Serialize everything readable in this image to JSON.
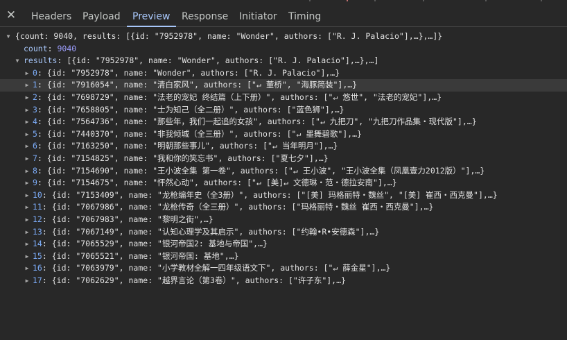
{
  "colors": {
    "background": "#282828",
    "tab_active": "#a8c7fa",
    "key": "#a8c7fa",
    "number": "#9e9fff"
  },
  "tabs": [
    {
      "label": "Headers"
    },
    {
      "label": "Payload"
    },
    {
      "label": "Preview"
    },
    {
      "label": "Response"
    },
    {
      "label": "Initiator"
    },
    {
      "label": "Timing"
    }
  ],
  "close_glyph": "✕",
  "tree": {
    "root_summary": "{count: 9040, results: [{id: \"7952978\", name: \"Wonder\", authors: [\"R. J. Palacio\"],…},…]}",
    "count_key": "count",
    "count_value": "9040",
    "results_key": "results",
    "results_summary": "[{id: \"7952978\", name: \"Wonder\", authors: [\"R. J. Palacio\"],…},…]",
    "items": [
      {
        "index": "0",
        "text": "{id: \"7952978\", name: \"Wonder\", authors: [\"R. J. Palacio\"],…}"
      },
      {
        "index": "1",
        "text": "{id: \"7916054\", name: \"清白家风\", authors: [\"↵ 董桥\", \"海豚简装\"],…}"
      },
      {
        "index": "2",
        "text": "{id: \"7698729\", name: \"法老的宠妃 终结篇（上下册）\", authors: [\"↵ 悠世\", \"法老的宠妃\"],…}"
      },
      {
        "index": "3",
        "text": "{id: \"7658805\", name: \"士为知己（全二册）\", authors: [\"蓝色狮\"],…}"
      },
      {
        "index": "4",
        "text": "{id: \"7564736\", name: \"那些年，我们一起追的女孩\", authors: [\"↵ 九把刀\", \"九把刀作品集・现代版\"],…}"
      },
      {
        "index": "5",
        "text": "{id: \"7440370\", name: \"非我倾城（全三册）\", authors: [\"↵ 墨舞碧歌\"],…}"
      },
      {
        "index": "6",
        "text": "{id: \"7163250\", name: \"明朝那些事儿\", authors: [\"↵ 当年明月\"],…}"
      },
      {
        "index": "7",
        "text": "{id: \"7154825\", name: \"我和你的笑忘书\", authors: [\"夏七夕\"],…}"
      },
      {
        "index": "8",
        "text": "{id: \"7154690\", name: \"王小波全集 第一卷\", authors: [\"↵ 王小波\", \"王小波全集（凤凰壹力2012版）\"],…}"
      },
      {
        "index": "9",
        "text": "{id: \"7154675\", name: \"怦然心动\", authors: [\"↵ [美]↵ 文德琳・范・德拉安南\"],…}"
      },
      {
        "index": "10",
        "text": "{id: \"7153409\", name: \"龙枪编年史（全3册）\", authors: [\"[美] 玛格丽特・魏丝\", \"[美] 崔西・西克曼\"],…}"
      },
      {
        "index": "11",
        "text": "{id: \"7067986\", name: \"龙枪传奇（全三册）\", authors: [\"玛格丽特・魏丝 崔西・西克曼\"],…}"
      },
      {
        "index": "12",
        "text": "{id: \"7067983\", name: \"黎明之街\",…}"
      },
      {
        "index": "13",
        "text": "{id: \"7067149\", name: \"认知心理学及其启示\", authors: [\"约翰•R•安德森\"],…}"
      },
      {
        "index": "14",
        "text": "{id: \"7065529\", name: \"银河帝国2: 基地与帝国\",…}"
      },
      {
        "index": "15",
        "text": "{id: \"7065521\", name: \"银河帝国: 基地\",…}"
      },
      {
        "index": "16",
        "text": "{id: \"7063979\", name: \"小学教材全解一四年级语文下\", authors: [\"↵ 薛金星\"],…}"
      },
      {
        "index": "17",
        "text": "{id: \"7062629\", name: \"越界言论（第3卷）\", authors: [\"许子东\"],…}"
      }
    ]
  }
}
